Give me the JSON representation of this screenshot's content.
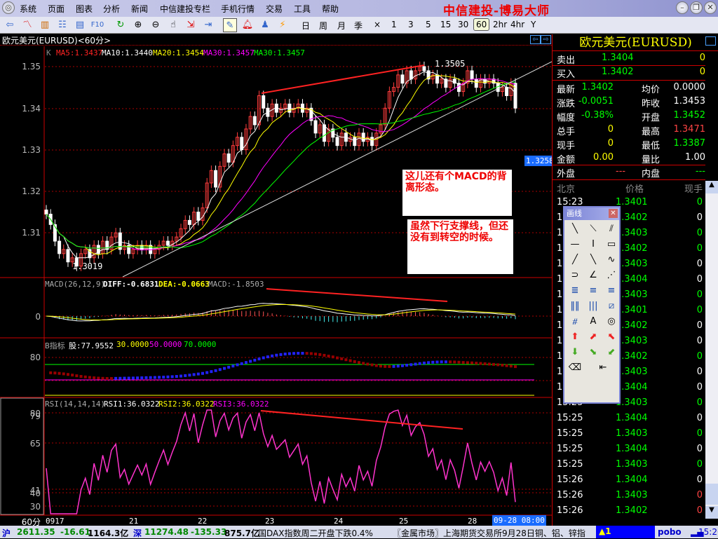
{
  "menu": [
    "系统",
    "页面",
    "图表",
    "分析",
    "新闻",
    "中信建投专栏",
    "手机行情",
    "交易",
    "工具",
    "帮助"
  ],
  "app_title": "中信建投-博易大师",
  "periods": [
    "日",
    "周",
    "月",
    "季",
    "×",
    "1",
    "3",
    "5",
    "15",
    "30",
    "60",
    "2hr",
    "4hr",
    "Y"
  ],
  "selected_period": "60",
  "chart": {
    "header": "欧元美元(EURUSD)<60分>",
    "ma_legend": {
      "k": "K",
      "ma5": "MA5:1.3437",
      "ma10": "MA10:1.3440",
      "ma20": "MA20:1.3454",
      "ma30a": "MA30:1.3457",
      "ma30b": "MA30:1.3457"
    },
    "price_axis": [
      "1.35",
      "1.34",
      "1.33",
      "1.32",
      "1.31"
    ],
    "high_label": "1.3505",
    "low_label": "1.3019",
    "current_tag": "1.3258",
    "notes": [
      "这儿还有个MACD的背离形态。",
      "虽然下行支撑线，但还没有到转空的时候。"
    ],
    "macd_legend": {
      "name": "MACD(26,12,9)",
      "diff": "DIFF:-0.6831",
      "dea": "DEA:-0.0663",
      "macd": "MACD:-1.8503"
    },
    "macd_axis": "0",
    "b_legend": {
      "name": "B指标",
      "v1": "股:77.9552",
      "v2": "30.0000",
      "v3": "50.0000",
      "v4": "70.0000"
    },
    "b_axis": "80",
    "rsi_legend": {
      "name": "RSI(14,14,14)",
      "r1": "RSI1:36.0322",
      "r2": "RSI2:36.0322",
      "r3": "RSI3:36.0322"
    },
    "rsi_axis": [
      "80",
      "79",
      "65",
      "41",
      "40",
      "30"
    ],
    "x_axis": {
      "period": "60分",
      "labels": [
        "0917",
        "21",
        "22",
        "23",
        "24",
        "25",
        "28"
      ],
      "cursor": "09-28 08:00"
    },
    "colors": {
      "up": "#ff3c3c",
      "down": "#ffffff",
      "ma5": "#ffffff",
      "ma10": "#ffff00",
      "ma20": "#ff00ff",
      "ma30": "#00ff00"
    }
  },
  "chart_data": {
    "type": "candlestick",
    "closes": [
      1.3145,
      1.312,
      1.308,
      1.305,
      1.306,
      1.303,
      1.304,
      1.302,
      1.305,
      1.306,
      1.304,
      1.307,
      1.305,
      1.308,
      1.306,
      1.309,
      1.31,
      1.306,
      1.307,
      1.305,
      1.306,
      1.307,
      1.306,
      1.307,
      1.305,
      1.306,
      1.307,
      1.308,
      1.307,
      1.308,
      1.309,
      1.311,
      1.313,
      1.312,
      1.315,
      1.313,
      1.316,
      1.322,
      1.325,
      1.321,
      1.326,
      1.329,
      1.327,
      1.331,
      1.333,
      1.33,
      1.335,
      1.338,
      1.336,
      1.343,
      1.34,
      1.338,
      1.341,
      1.339,
      1.34,
      1.341,
      1.339,
      1.34,
      1.341,
      1.339,
      1.34,
      1.337,
      1.334,
      1.336,
      1.332,
      1.335,
      1.333,
      1.331,
      1.334,
      1.332,
      1.333,
      1.331,
      1.334,
      1.332,
      1.333,
      1.331,
      1.334,
      1.336,
      1.34,
      1.344,
      1.345,
      1.348,
      1.346,
      1.349,
      1.347,
      1.349,
      1.35,
      1.349,
      1.347,
      1.348,
      1.346,
      1.347,
      1.345,
      1.347,
      1.346,
      1.344,
      1.346,
      1.349,
      1.347,
      1.345,
      1.347,
      1.346,
      1.347,
      1.346,
      1.344,
      1.345,
      1.343,
      1.346,
      1.34
    ],
    "ylim": [
      1.3,
      1.355
    ]
  },
  "quote": {
    "title": "欧元美元(EURUSD)",
    "sell": {
      "label": "卖出",
      "price": "1.3404",
      "vol": "0"
    },
    "buy": {
      "label": "买入",
      "price": "1.3402",
      "vol": "0"
    },
    "stats": [
      [
        "最新",
        "1.3402",
        "均价",
        "0.0000"
      ],
      [
        "涨跌",
        "-0.0051",
        "昨收",
        "1.3453"
      ],
      [
        "幅度",
        "-0.38%",
        "开盘",
        "1.3452"
      ],
      [
        "总手",
        "0",
        "最高",
        "1.3471"
      ],
      [
        "现手",
        "0",
        "最低",
        "1.3387"
      ],
      [
        "金额",
        "0.00",
        "量比",
        "1.00"
      ]
    ],
    "outer": {
      "label": "外盘",
      "value": "---",
      "label2": "内盘",
      "value2": "---"
    },
    "tick_header": [
      "北京",
      "价格",
      "现手"
    ],
    "ticks": [
      [
        "15:23",
        "1.3401",
        "0",
        "g"
      ],
      [
        "15:23",
        "1.3402",
        "0",
        "w"
      ],
      [
        "15:23",
        "1.3403",
        "0",
        "g"
      ],
      [
        "15:23",
        "1.3402",
        "0",
        "g"
      ],
      [
        "15:23",
        "1.3403",
        "0",
        "w"
      ],
      [
        "15:24",
        "1.3404",
        "0",
        "w"
      ],
      [
        "15:24",
        "1.3403",
        "0",
        "g"
      ],
      [
        "15:24",
        "1.3401",
        "0",
        "g"
      ],
      [
        "15:24",
        "1.3402",
        "0",
        "w"
      ],
      [
        "15:24",
        "1.3403",
        "0",
        "w"
      ],
      [
        "15:24",
        "1.3402",
        "0",
        "g"
      ],
      [
        "15:24",
        "1.3403",
        "0",
        "w"
      ],
      [
        "15:24",
        "1.3404",
        "0",
        "w"
      ],
      [
        "15:25",
        "1.3403",
        "0",
        "g"
      ],
      [
        "15:25",
        "1.3404",
        "0",
        "w"
      ],
      [
        "15:25",
        "1.3403",
        "0",
        "g"
      ],
      [
        "15:25",
        "1.3404",
        "0",
        "w"
      ],
      [
        "15:25",
        "1.3403",
        "0",
        "g"
      ],
      [
        "15:26",
        "1.3404",
        "0",
        "w"
      ],
      [
        "15:26",
        "1.3403",
        "0",
        "r"
      ],
      [
        "15:26",
        "1.3402",
        "0",
        "r"
      ]
    ]
  },
  "toolbox": {
    "title": "画线"
  },
  "status": {
    "sh_label": "沪",
    "sh_index": "2611.35",
    "sh_change": "-16.61",
    "sh_amount": "1164.3亿",
    "sz_label": "深",
    "sz_index": "11274.48",
    "sz_change": "-135.33",
    "sz_amount": "875.7亿",
    "news1": "国DAX指数周二开盘下跌0.4%",
    "news2": "〖金属市场〗上海期货交易所9月28日铜、铝、锌指",
    "alert": "▲1",
    "brand": "pobo",
    "time": "15:26"
  }
}
